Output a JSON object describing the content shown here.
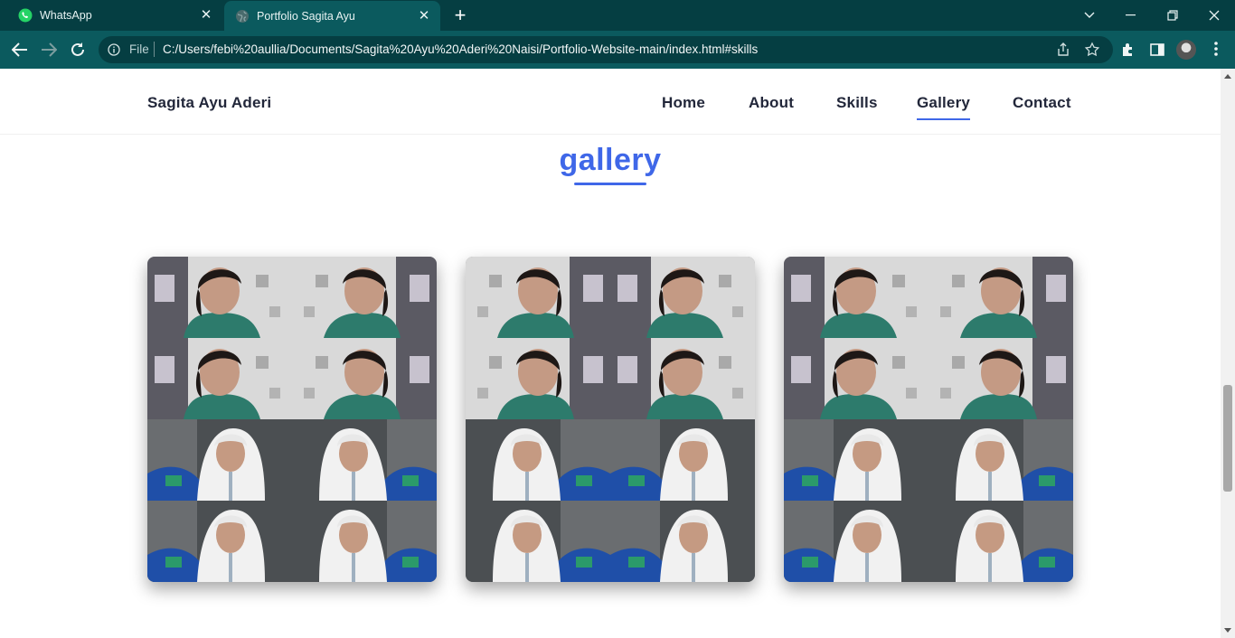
{
  "browser": {
    "tabs": [
      {
        "title": "WhatsApp",
        "icon": "whatsapp-icon",
        "active": false
      },
      {
        "title": "Portfolio Sagita Ayu",
        "icon": "globe-icon",
        "active": true
      }
    ],
    "address_bar": {
      "scheme_label": "File",
      "url": "C:/Users/febi%20aullia/Documents/Sagita%20Ayu%20Aderi%20Naisi/Portfolio-Website-main/index.html#skills"
    },
    "colors": {
      "frame": "#053e42",
      "toolbar": "#0b5a5e"
    }
  },
  "site": {
    "brand": "Sagita Ayu Aderi",
    "nav": [
      {
        "label": "Home",
        "active": false
      },
      {
        "label": "About",
        "active": false
      },
      {
        "label": "Skills",
        "active": false
      },
      {
        "label": "Gallery",
        "active": true
      },
      {
        "label": "Contact",
        "active": false
      }
    ],
    "accent_color": "#3f67e8"
  },
  "gallery": {
    "title": "gallery",
    "cards": [
      {
        "top_collage": "selfie collage, green shirt",
        "bottom_collage": "selfie collage, white hijab"
      },
      {
        "top_collage": "selfie collage, green shirt",
        "bottom_collage": "selfie collage, white hijab"
      },
      {
        "top_collage": "selfie collage, green shirt",
        "bottom_collage": "selfie collage, white hijab"
      }
    ]
  }
}
